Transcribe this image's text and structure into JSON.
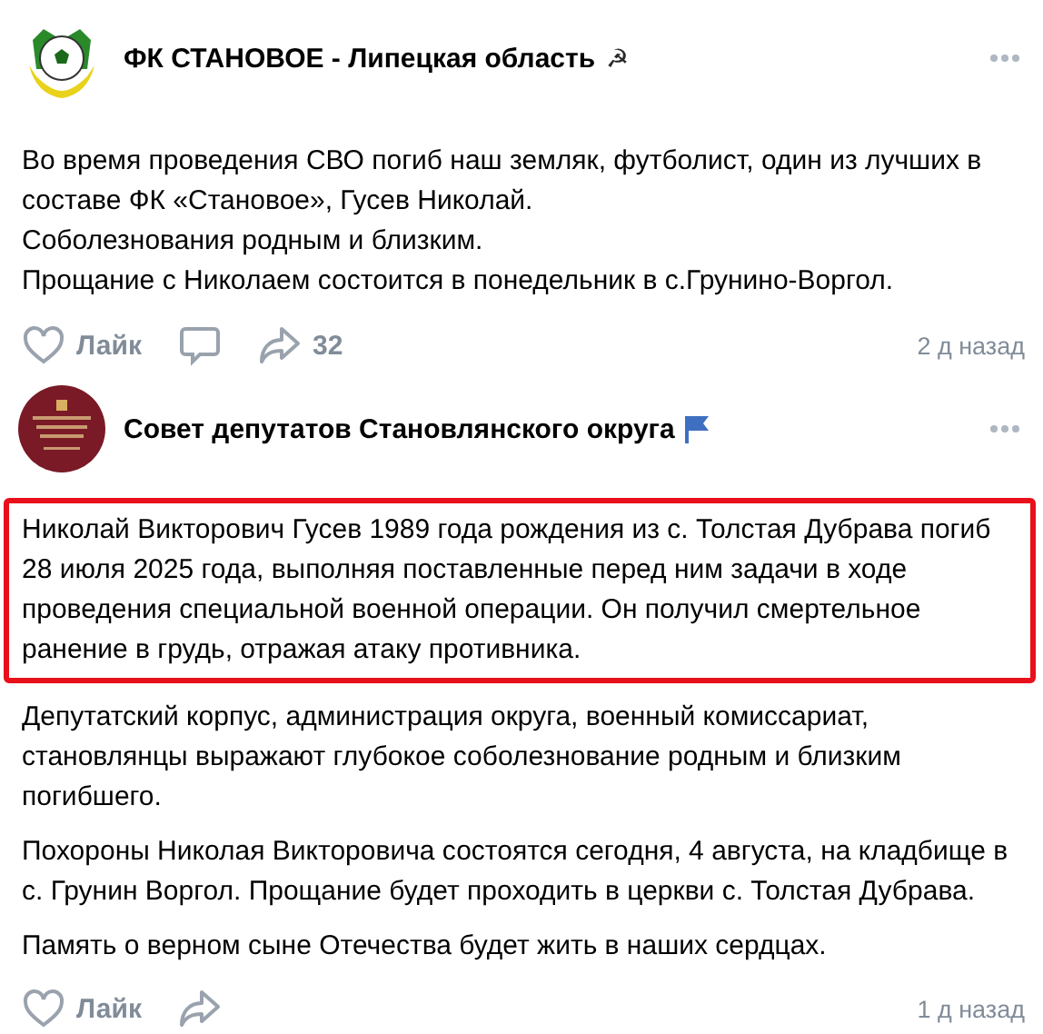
{
  "posts": [
    {
      "author": "ФК СТАНОВОЕ - Липецкая область",
      "avatar": {
        "kind": "ball"
      },
      "badge": {
        "kind": "symbol",
        "text": "☭"
      },
      "paragraphs": [
        {
          "text": "Во время проведения СВО погиб наш земляк, футболист, один из лучших в составе ФК «Становое», Гусев Николай.\nСоболезнования родным и близким.\nПрощание с Николаем состоится в понедельник в с.Грунино-Воргол.",
          "highlighted": false
        }
      ],
      "actions": [
        {
          "kind": "like",
          "label": "Лайк"
        },
        {
          "kind": "comment"
        },
        {
          "kind": "share",
          "count": "32"
        }
      ],
      "time": "2 д назад"
    },
    {
      "author": "Совет депутатов Становлянского округа",
      "avatar": {
        "kind": "emblem"
      },
      "badge": {
        "kind": "flag"
      },
      "paragraphs": [
        {
          "text": "Николай Викторович Гусев 1989 года рождения из с. Толстая Дубрава погиб 28 июля 2025 года, выполняя поставленные перед ним задачи в ходе проведения специальной военной операции. Он получил смертельное ранение в грудь, отражая атаку противника.",
          "highlighted": true
        },
        {
          "text": "Депутатский корпус, администрация округа, военный комиссариат, становлянцы выражают глубокое соболезнование родным и близким погибшего.",
          "highlighted": false
        },
        {
          "text": "Похороны Николая Викторовича состоятся сегодня, 4 августа, на кладбище в с. Грунин Воргол. Прощание будет проходить в церкви с. Толстая Дубрава.",
          "highlighted": false
        },
        {
          "text": "Память о верном сыне Отечества будет жить в наших сердцах.",
          "highlighted": false
        }
      ],
      "actions": [
        {
          "kind": "like",
          "label": "Лайк"
        },
        {
          "kind": "share"
        }
      ],
      "time": "1 д назад"
    }
  ]
}
